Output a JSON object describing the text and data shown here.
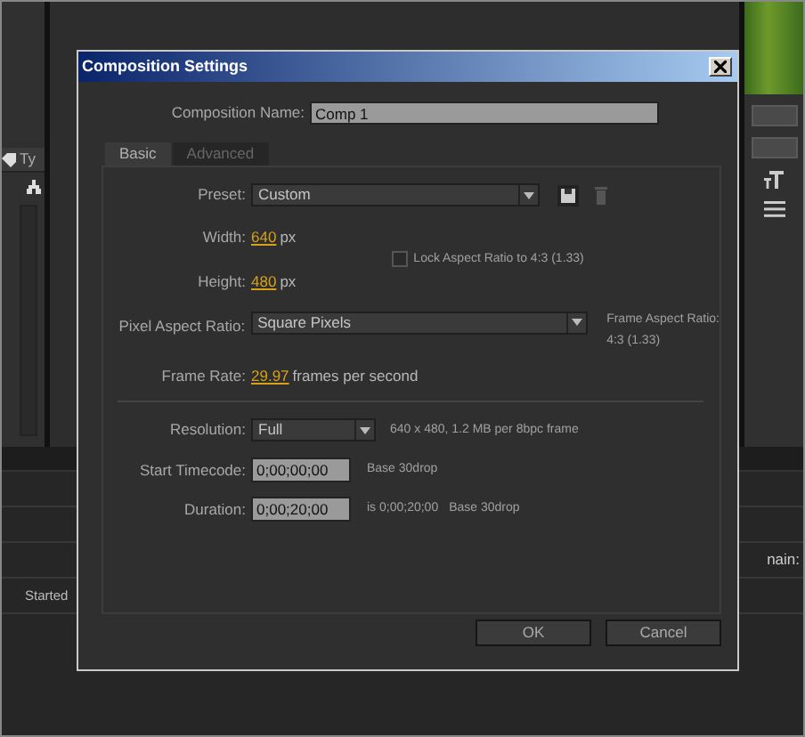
{
  "window": {
    "title": "Composition Settings"
  },
  "composition_name": {
    "label": "Composition Name:",
    "value": "Comp 1"
  },
  "tabs": [
    {
      "label": "Basic",
      "selected": true
    },
    {
      "label": "Advanced",
      "selected": false
    }
  ],
  "preset": {
    "label": "Preset:",
    "value": "Custom"
  },
  "width": {
    "label": "Width:",
    "value": "640",
    "unit": "px"
  },
  "height": {
    "label": "Height:",
    "value": "480",
    "unit": "px"
  },
  "lock_aspect": {
    "label": "Lock Aspect Ratio to 4:3 (1.33)",
    "checked": false
  },
  "pixel_aspect_ratio": {
    "label": "Pixel Aspect Ratio:",
    "value": "Square Pixels"
  },
  "frame_aspect": [
    "Frame Aspect Ratio:",
    "4:3 (1.33)"
  ],
  "frame_rate": {
    "label": "Frame Rate:",
    "value": "29.97",
    "unit": "frames per second"
  },
  "resolution": {
    "label": "Resolution:",
    "value": "Full",
    "info": "640 x 480, 1.2 MB per 8bpc frame"
  },
  "start_timecode": {
    "label": "Start Timecode:",
    "value": "0;00;00;00",
    "notes": [
      "Base 30drop"
    ]
  },
  "duration": {
    "label": "Duration:",
    "value": "0;00;20;00",
    "notes": [
      "is 0;00;20;00",
      "Base 30drop"
    ]
  },
  "buttons": [
    "OK",
    "Cancel"
  ],
  "background": {
    "left_tab": "Ty",
    "left_row": "Started",
    "right_label": "nain:"
  }
}
